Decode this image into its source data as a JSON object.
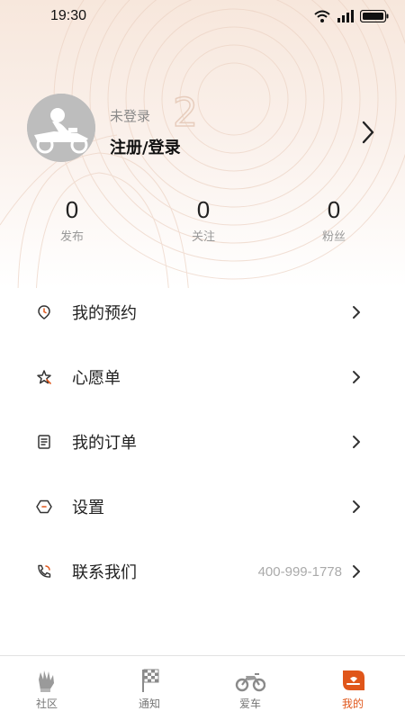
{
  "status_bar": {
    "time": "19:30"
  },
  "profile": {
    "hint": "未登录",
    "action": "注册/登录"
  },
  "stats": [
    {
      "value": "0",
      "label": "发布"
    },
    {
      "value": "0",
      "label": "关注"
    },
    {
      "value": "0",
      "label": "粉丝"
    }
  ],
  "menu": [
    {
      "label": "我的预约",
      "icon": "calendar-pin-icon"
    },
    {
      "label": "心愿单",
      "icon": "star-icon"
    },
    {
      "label": "我的订单",
      "icon": "order-list-icon"
    },
    {
      "label": "设置",
      "icon": "hexagon-settings-icon"
    },
    {
      "label": "联系我们",
      "icon": "phone-icon",
      "extra": "400-999-1778"
    }
  ],
  "tabs": [
    {
      "label": "社区",
      "icon": "glove-icon"
    },
    {
      "label": "通知",
      "icon": "checkered-flag-icon"
    },
    {
      "label": "爱车",
      "icon": "motorcycle-icon"
    },
    {
      "label": "我的",
      "icon": "profile-icon",
      "active": true
    }
  ],
  "colors": {
    "accent": "#e0561a",
    "header_tint": "#f7e7dc"
  }
}
